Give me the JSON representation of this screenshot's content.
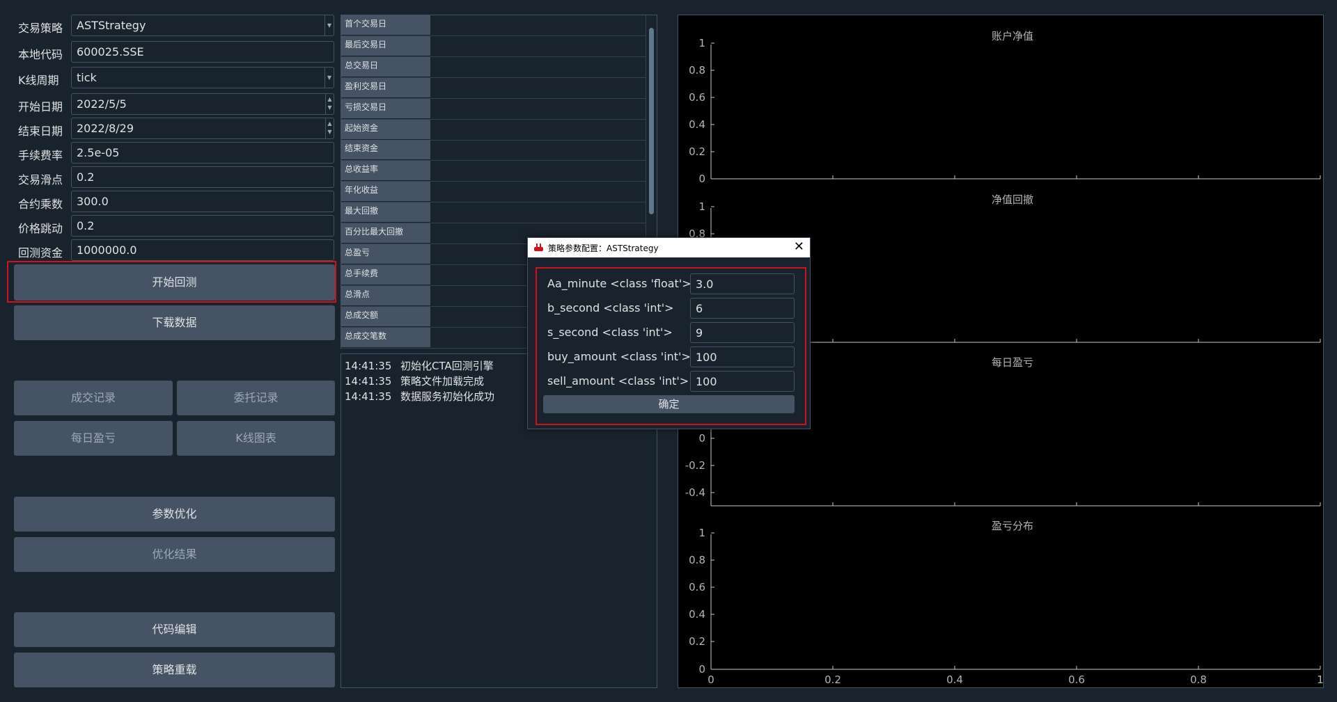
{
  "form": {
    "fields": [
      {
        "label": "交易策略",
        "value": "ASTStrategy",
        "kind": "combo"
      },
      {
        "label": "本地代码",
        "value": "600025.SSE",
        "kind": "text"
      },
      {
        "label": "K线周期",
        "value": "tick",
        "kind": "combo"
      },
      {
        "label": "开始日期",
        "value": "2022/5/5",
        "kind": "date"
      },
      {
        "label": "结束日期",
        "value": "2022/8/29",
        "kind": "date"
      },
      {
        "label": "手续费率",
        "value": "2.5e-05",
        "kind": "text"
      },
      {
        "label": "交易滑点",
        "value": "0.2",
        "kind": "text"
      },
      {
        "label": "合约乘数",
        "value": "300.0",
        "kind": "text"
      },
      {
        "label": "价格跳动",
        "value": "0.2",
        "kind": "text"
      },
      {
        "label": "回测资金",
        "value": "1000000.0",
        "kind": "text"
      }
    ]
  },
  "buttons": {
    "start_backtest": "开始回测",
    "download_data": "下载数据",
    "trade_records": "成交记录",
    "order_records": "委托记录",
    "daily_pnl": "每日盈亏",
    "kline_chart": "K线图表",
    "optimize": "参数优化",
    "optimize_result": "优化结果",
    "code_edit": "代码编辑",
    "reload_strategy": "策略重载"
  },
  "stats": {
    "labels": [
      "首个交易日",
      "最后交易日",
      "总交易日",
      "盈利交易日",
      "亏损交易日",
      "起始资金",
      "结束资金",
      "总收益率",
      "年化收益",
      "最大回撤",
      "百分比最大回撤",
      "总盈亏",
      "总手续费",
      "总滑点",
      "总成交额",
      "总成交笔数"
    ]
  },
  "log": {
    "lines": [
      {
        "time": "14:41:35",
        "msg": "初始化CTA回测引擎"
      },
      {
        "time": "14:41:35",
        "msg": "策略文件加载完成"
      },
      {
        "time": "14:41:35",
        "msg": "数据服务初始化成功"
      }
    ]
  },
  "charts": {
    "titles": [
      "账户净值",
      "净值回撤",
      "每日盈亏",
      "盈亏分布"
    ],
    "chart1_y_ticks": [
      "1",
      "0.8",
      "0.6",
      "0.4",
      "0.2",
      "0"
    ],
    "chart2_y_ticks": [
      "1",
      "0.8"
    ],
    "chart3_y_ticks": [
      "0",
      "-0.2",
      "-0.4"
    ],
    "chart4_y_ticks": [
      "1",
      "0.8",
      "0.6",
      "0.4",
      "0.2",
      "0"
    ],
    "x_ticks": [
      "0",
      "0.2",
      "0.4",
      "0.6",
      "0.8",
      "1"
    ]
  },
  "dialog": {
    "title": "策略参数配置：ASTStrategy",
    "params": [
      {
        "label": "Aa_minute <class 'float'>",
        "value": "3.0"
      },
      {
        "label": "b_second <class 'int'>",
        "value": "6"
      },
      {
        "label": "s_second <class 'int'>",
        "value": "9"
      },
      {
        "label": "buy_amount <class 'int'>",
        "value": "100"
      },
      {
        "label": "sell_amount <class 'int'>",
        "value": "100"
      }
    ],
    "confirm": "确定"
  },
  "colors": {
    "background": "#19232d",
    "button": "#455364",
    "highlight": "#d0121b",
    "chart_bg": "#000000"
  }
}
